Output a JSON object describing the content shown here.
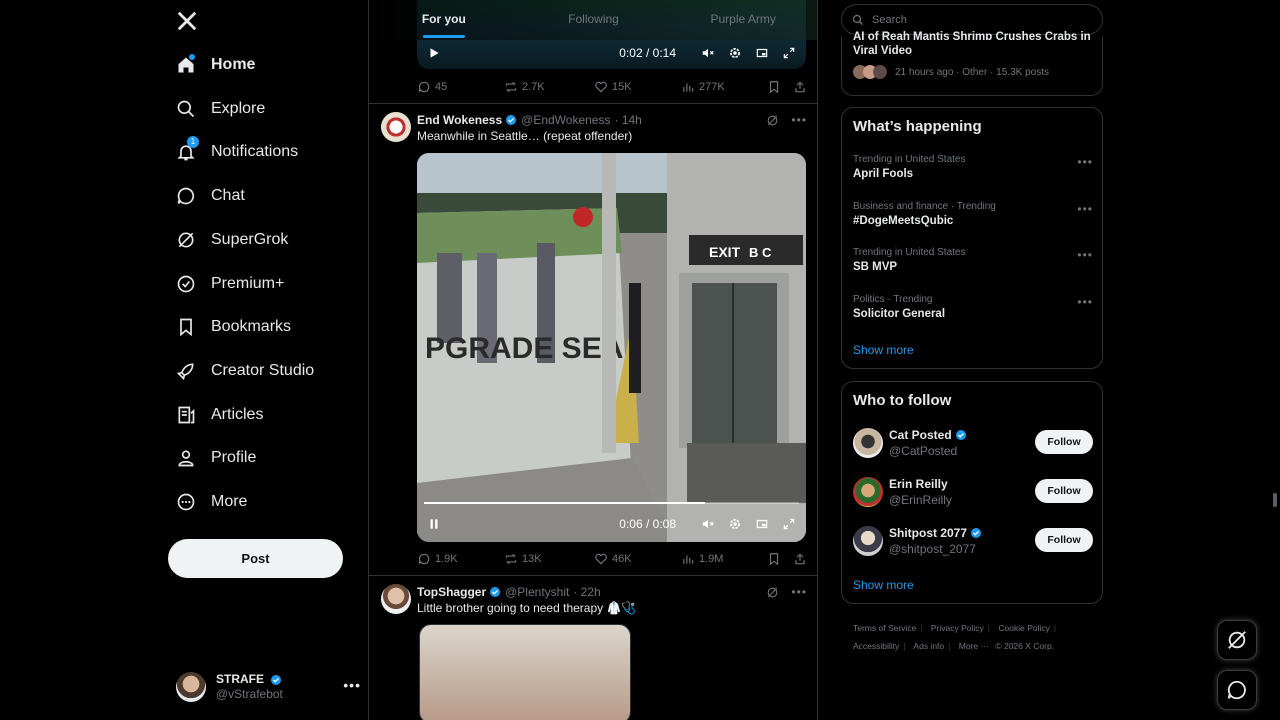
{
  "nav": {
    "items": [
      {
        "label": "Home",
        "icon": "home-icon"
      },
      {
        "label": "Explore",
        "icon": "search-icon"
      },
      {
        "label": "Notifications",
        "icon": "bell-icon",
        "badge": "1"
      },
      {
        "label": "Chat",
        "icon": "chat-icon"
      },
      {
        "label": "SuperGrok",
        "icon": "grok-icon"
      },
      {
        "label": "Premium+",
        "icon": "verified-icon"
      },
      {
        "label": "Bookmarks",
        "icon": "bookmark-icon"
      },
      {
        "label": "Creator Studio",
        "icon": "rocket-icon"
      },
      {
        "label": "Articles",
        "icon": "article-icon"
      },
      {
        "label": "Profile",
        "icon": "person-icon"
      },
      {
        "label": "More",
        "icon": "more-circle-icon"
      }
    ],
    "post_label": "Post",
    "account": {
      "name": "STRAFE",
      "handle": "@vStrafebot"
    }
  },
  "feed": {
    "tabs": [
      "For you",
      "Following",
      "Purple Army"
    ],
    "active_tab": "For you",
    "top_video": {
      "time": "0:02 / 0:14"
    },
    "top_actions": {
      "replies": "45",
      "reposts": "2.7K",
      "likes": "15K",
      "views": "277K"
    },
    "tweet1": {
      "name": "End Wokeness",
      "handle": "@EndWokeness",
      "age": "· 14h",
      "text": "Meanwhile in Seattle… (repeat offender)",
      "video_time": "0:06 / 0:08",
      "progress": 0.75,
      "sign_exit": "EXIT",
      "sign_lines": "B C",
      "car_text": "PGRADE SEA",
      "actions": {
        "replies": "1.9K",
        "reposts": "13K",
        "likes": "46K",
        "views": "1.9M"
      }
    },
    "tweet2": {
      "name": "TopShagger",
      "handle": "@Plentyshit",
      "age": "· 22h",
      "text": "Little brother going to need therapy 🥼🩺"
    }
  },
  "right": {
    "search_placeholder": "Search",
    "top_card": {
      "title_line1": "AI of Reah Mantis Shrimp Crushes Crabs in",
      "title_line2": "Viral Video",
      "meta": "21 hours ago · Other · 15.3K posts"
    },
    "happening_title": "What’s happening",
    "trends": [
      {
        "meta": "Trending in United States",
        "topic": "April Fools"
      },
      {
        "meta": "Business and finance · Trending",
        "topic": "#DogeMeetsQubic"
      },
      {
        "meta": "Trending in United States",
        "topic": "SB MVP"
      },
      {
        "meta": "Politics · Trending",
        "topic": "Solicitor General"
      }
    ],
    "show_more": "Show more",
    "who_title": "Who to follow",
    "who": [
      {
        "name": "Cat Posted",
        "handle": "@CatPosted",
        "verified": true
      },
      {
        "name": "Erin Reilly",
        "handle": "@ErinReilly",
        "verified": false
      },
      {
        "name": "Shitpost 2077",
        "handle": "@shitpost_2077",
        "verified": true
      }
    ],
    "follow_label": "Follow",
    "footer": {
      "terms": "Terms of Service",
      "privacy": "Privacy Policy",
      "cookie": "Cookie Policy",
      "accessibility": "Accessibility",
      "ads": "Ads info",
      "more": "More ···",
      "copyright": "© 2026 X Corp."
    }
  },
  "colors": {
    "accent": "#1d9bf0",
    "background": "#000000",
    "border": "#2f3336",
    "muted": "#71767b"
  }
}
